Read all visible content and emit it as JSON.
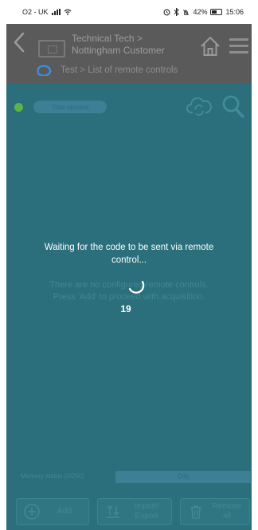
{
  "status_bar": {
    "carrier": "O2 - UK",
    "battery": "42%",
    "time": "15:06"
  },
  "header": {
    "breadcrumb_line1": "Technical Tech >",
    "breadcrumb_line2": "Nottingham Customer",
    "subtitle": "Test > List of remote controls"
  },
  "toolbar": {
    "status_pill": "Total opened"
  },
  "empty_state": {
    "line1": "There are no configured remote controls.",
    "line2": "Press 'Add' to proceed with acquisition."
  },
  "overlay": {
    "message": "Waiting for the code to be sent via remote control...",
    "countdown": "19"
  },
  "memory": {
    "label": "Memory status (0/250)",
    "percent_text": "0%",
    "fill_fraction": 0
  },
  "actions": {
    "add": "Add",
    "import_line1": "Import/",
    "import_line2": "Export",
    "remove_line1": "Remove",
    "remove_line2": "all"
  },
  "colors": {
    "header_bg": "#5a5a5a",
    "main_bg": "#2a6f7b",
    "status_green": "#5ab548"
  },
  "icons": [
    "back-icon",
    "device-icon",
    "home-icon",
    "menu-icon",
    "sync-icon",
    "cloud-sync-icon",
    "search-icon",
    "add-icon",
    "import-export-icon",
    "trash-icon",
    "signal-icon",
    "wifi-icon",
    "battery-icon"
  ]
}
